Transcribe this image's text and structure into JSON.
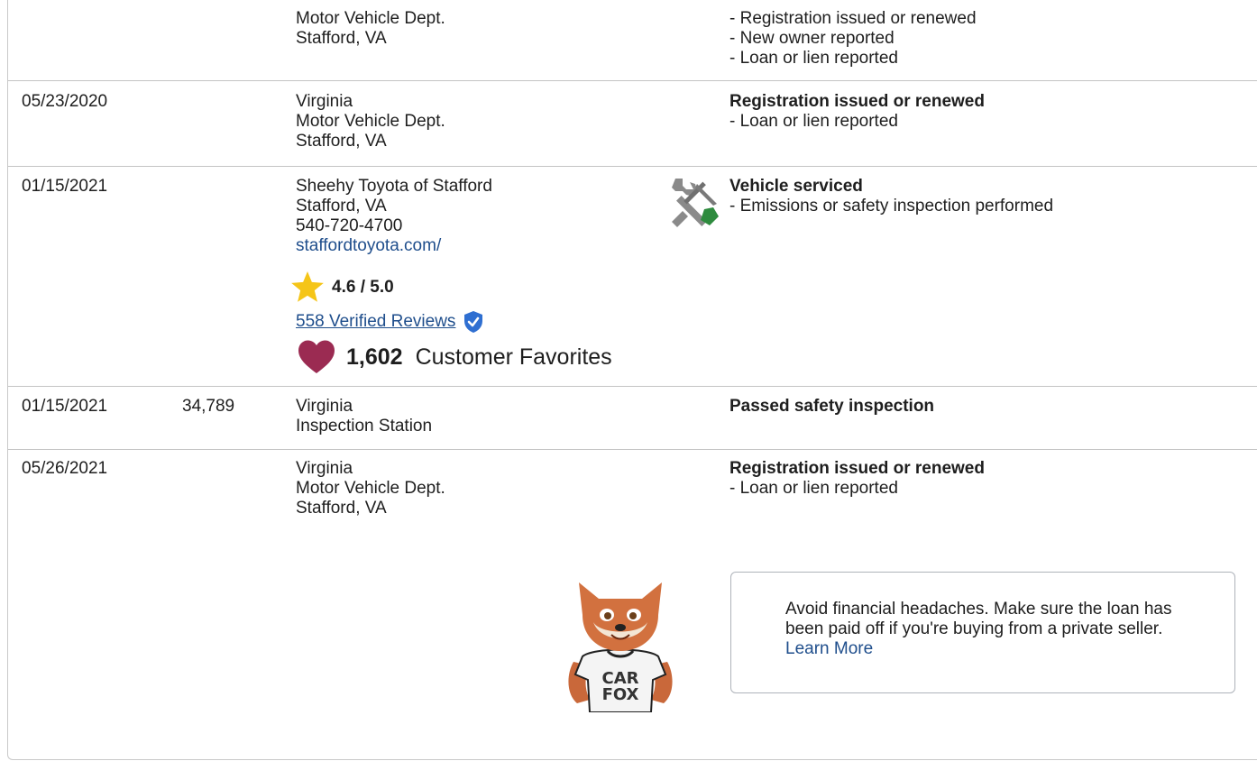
{
  "rows": [
    {
      "date": "",
      "odometer": "",
      "source": [
        "Motor Vehicle Dept.",
        "Stafford, VA"
      ],
      "heading": "",
      "details": [
        "- Registration issued or renewed",
        "- New owner reported",
        "- Loan or lien reported"
      ]
    },
    {
      "date": "05/23/2020",
      "odometer": "",
      "source": [
        "Virginia",
        "Motor Vehicle Dept.",
        "Stafford, VA"
      ],
      "heading": "Registration issued or renewed",
      "details": [
        "- Loan or lien reported"
      ]
    },
    {
      "date": "01/15/2021",
      "odometer": "",
      "source": [
        "Sheehy Toyota of Stafford",
        "Stafford, VA",
        "540-720-4700"
      ],
      "source_link": "staffordtoyota.com/",
      "rating": "4.6 / 5.0",
      "reviews_link": "558 Verified Reviews",
      "favorites_count": "1,602",
      "favorites_label": "Customer Favorites",
      "service_icon": "wrench-screwdriver-icon",
      "heading": "Vehicle serviced",
      "details": [
        "- Emissions or safety inspection performed"
      ]
    },
    {
      "date": "01/15/2021",
      "odometer": "34,789",
      "source": [
        "Virginia",
        "Inspection Station"
      ],
      "heading": "Passed safety inspection",
      "details": []
    },
    {
      "date": "05/26/2021",
      "odometer": "",
      "source": [
        "Virginia",
        "Motor Vehicle Dept.",
        "Stafford, VA"
      ],
      "heading": "Registration issued or renewed",
      "details": [
        "- Loan or lien reported"
      ]
    }
  ],
  "tip": {
    "text": "Avoid financial headaches. Make sure the loan has been paid off if you're buying from a private seller.",
    "link": "Learn More"
  },
  "mascot": {
    "shirt_line1": "CAR",
    "shirt_line2": "FOX"
  },
  "colors": {
    "link": "#1f4e8c",
    "star": "#f5c518",
    "heart": "#9b2b52",
    "verified": "#2f6fd1",
    "screwdriver": "#2e8b3e"
  }
}
